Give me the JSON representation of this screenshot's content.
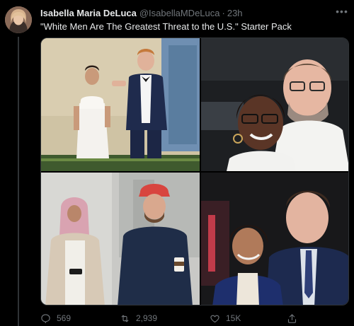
{
  "tweet": {
    "author_name": "Isabella Maria DeLuca",
    "handle": "@IsabellaMDeLuca",
    "separator": "·",
    "time": "23h",
    "text": "\"White Men Are The Greatest Threat to the U.S.\" Starter Pack",
    "more_label": "•••"
  },
  "media": {
    "photos": [
      {
        "name": "couple-formal-event"
      },
      {
        "name": "couple-selfie"
      },
      {
        "name": "couple-street-coffee"
      },
      {
        "name": "couple-smiling-event"
      }
    ]
  },
  "actions": {
    "replies": "569",
    "retweets": "2,939",
    "likes": "15K",
    "share_icon": "share-icon"
  },
  "colors": {
    "background": "#000000",
    "text": "#e7e9ea",
    "muted": "#71767b",
    "border": "#2f3336"
  }
}
